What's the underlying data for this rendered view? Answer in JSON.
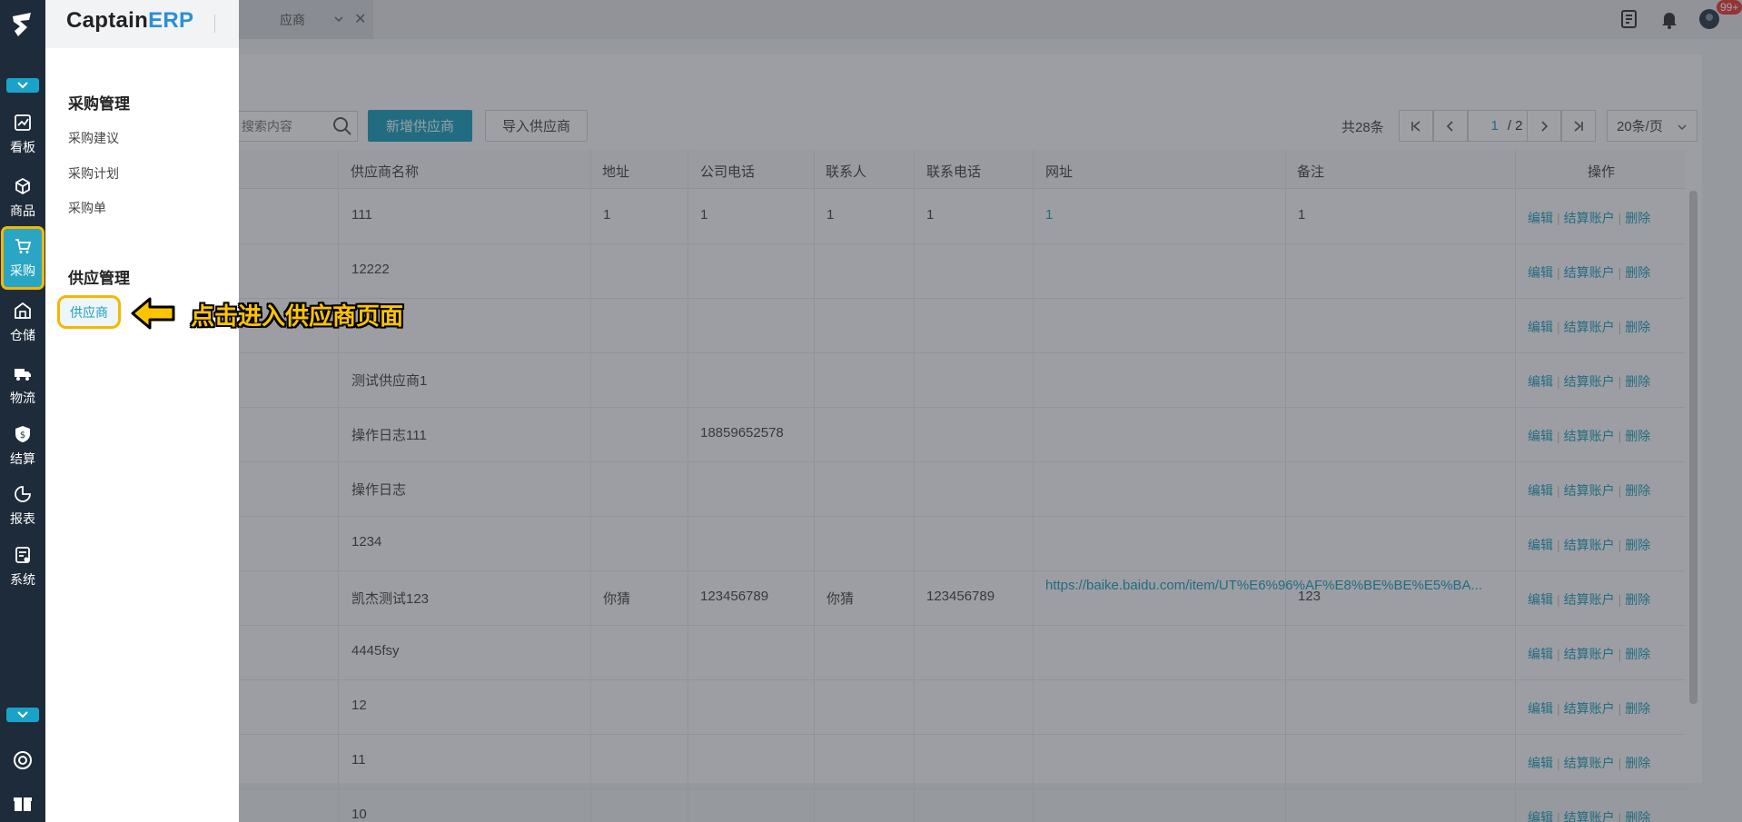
{
  "rail": {
    "items": [
      {
        "label": "看板",
        "icon": "chart-icon"
      },
      {
        "label": "商品",
        "icon": "box-icon"
      },
      {
        "label": "采购",
        "icon": "cart-icon",
        "active": true
      },
      {
        "label": "仓储",
        "icon": "warehouse-icon"
      },
      {
        "label": "物流",
        "icon": "truck-icon"
      },
      {
        "label": "结算",
        "icon": "shield-money-icon"
      },
      {
        "label": "报表",
        "icon": "pie-icon"
      },
      {
        "label": "系统",
        "icon": "system-icon"
      }
    ]
  },
  "header": {
    "tab_label": "应商",
    "badge": "99+"
  },
  "brand": {
    "prefix": "Captain",
    "suffix": "ERP"
  },
  "flyout": {
    "group1_title": "采购管理",
    "group1_items": [
      "采购建议",
      "采购计划",
      "采购单"
    ],
    "group2_title": "供应管理",
    "group2_item": "供应商"
  },
  "callout": "点击进入供应商页面",
  "toolbar": {
    "search_placeholder": "搜索内容",
    "add_label": "新增供应商",
    "import_label": "导入供应商"
  },
  "pagination": {
    "total": "共28条",
    "current": "1",
    "pages": "/ 2",
    "page_size": "20条/页"
  },
  "table": {
    "headers": [
      "供应商名称",
      "地址",
      "公司电话",
      "联系人",
      "联系电话",
      "网址",
      "备注",
      "操作"
    ],
    "ops": [
      "编辑",
      "结算账户",
      "删除"
    ],
    "rows": [
      {
        "name": "111",
        "address": "1",
        "phone": "1",
        "contact": "1",
        "mobile": "1",
        "url": "1",
        "note": "1"
      },
      {
        "name": "12222",
        "address": "",
        "phone": "",
        "contact": "",
        "mobile": "",
        "url": "",
        "note": ""
      },
      {
        "name": "",
        "address": "",
        "phone": "",
        "contact": "",
        "mobile": "",
        "url": "",
        "note": ""
      },
      {
        "name": "测试供应商1",
        "address": "",
        "phone": "",
        "contact": "",
        "mobile": "",
        "url": "",
        "note": ""
      },
      {
        "name": "操作日志111",
        "address": "",
        "phone": "18859652578",
        "contact": "",
        "mobile": "",
        "url": "",
        "note": ""
      },
      {
        "name": "操作日志",
        "address": "",
        "phone": "",
        "contact": "",
        "mobile": "",
        "url": "",
        "note": ""
      },
      {
        "name": "1234",
        "address": "",
        "phone": "",
        "contact": "",
        "mobile": "",
        "url": "",
        "note": ""
      },
      {
        "name": "凯杰测试123",
        "address": "你猜",
        "phone": "123456789",
        "contact": "你猜",
        "mobile": "123456789",
        "url": "https://baike.baidu.com/item/UT%E6%96%AF%E8%BE%BE%E5%BA...",
        "note": "123"
      },
      {
        "name": "4445fsy",
        "address": "",
        "phone": "",
        "contact": "",
        "mobile": "",
        "url": "",
        "note": ""
      },
      {
        "name": "12",
        "address": "",
        "phone": "",
        "contact": "",
        "mobile": "",
        "url": "",
        "note": ""
      },
      {
        "name": "11",
        "address": "",
        "phone": "",
        "contact": "",
        "mobile": "",
        "url": "",
        "note": ""
      },
      {
        "name": "10",
        "address": "",
        "phone": "",
        "contact": "",
        "mobile": "",
        "url": "",
        "note": ""
      }
    ]
  },
  "colors": {
    "accent": "#1e9bbb",
    "highlight": "#f5b800",
    "rail": "#1e2b3a"
  }
}
